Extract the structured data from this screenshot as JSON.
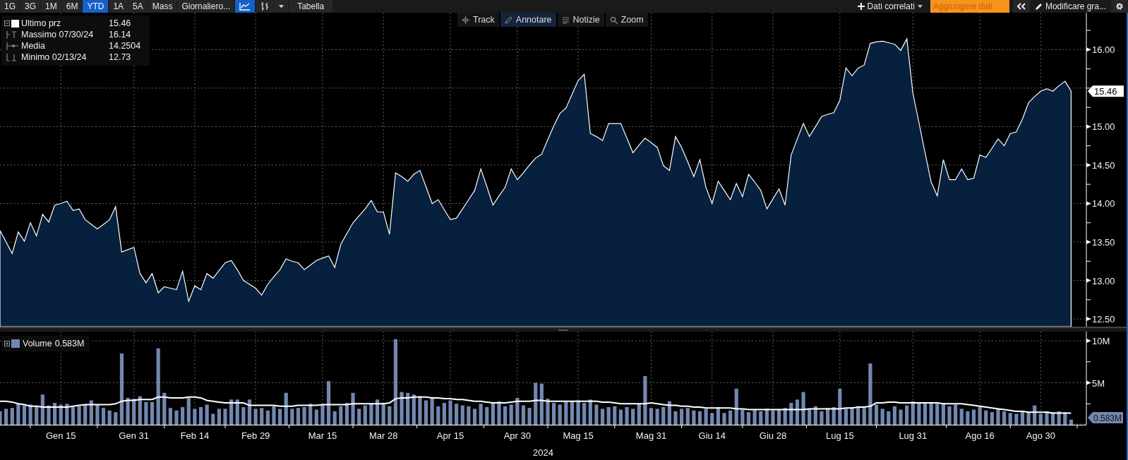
{
  "toolbar": {
    "periods": [
      {
        "label": "1G",
        "selected": false
      },
      {
        "label": "3G",
        "selected": false
      },
      {
        "label": "1M",
        "selected": false
      },
      {
        "label": "6M",
        "selected": false
      },
      {
        "label": "YTD",
        "selected": true
      },
      {
        "label": "1A",
        "selected": false
      },
      {
        "label": "5A",
        "selected": false
      },
      {
        "label": "Mass",
        "selected": false
      }
    ],
    "frequency": "Giornaliero...",
    "chart_types": [
      {
        "kind": "line",
        "selected": true
      },
      {
        "kind": "bars",
        "selected": false
      }
    ],
    "table_button": "Tabella",
    "related_data": "Dati correlati",
    "add_data": {
      "placeholder": "Aggiungere dati"
    },
    "edit_chart": "Modificare gra..."
  },
  "price_panel": {
    "legend": [
      {
        "kind": "last",
        "value": "15.46"
      },
      {
        "kind": "high",
        "label": "Massimo 07/30/24",
        "value": "16.14"
      },
      {
        "kind": "average",
        "label": "Media",
        "value": "14.2504"
      },
      {
        "kind": "low",
        "label": "Minimo 02/13/24",
        "value": "12.73"
      }
    ],
    "tools": [
      {
        "kind": "track",
        "label": "Track",
        "selected": false
      },
      {
        "kind": "annotate",
        "label": "Annotare",
        "selected": true
      },
      {
        "kind": "news",
        "label": "Notizie",
        "selected": false
      },
      {
        "kind": "zoom",
        "label": "Zoom",
        "selected": false
      }
    ],
    "last_tag": "15.46",
    "chart_data": {
      "type": "area",
      "grid": true,
      "ylim": [
        12.4,
        16.48
      ],
      "series": [
        {
          "name": "Ultimo prz",
          "color": "#ffffff",
          "values": [
            13.65,
            13.5,
            13.35,
            13.63,
            13.51,
            13.75,
            13.58,
            13.86,
            13.76,
            13.98,
            14.0,
            14.03,
            13.91,
            13.93,
            13.79,
            13.73,
            13.67,
            13.73,
            13.79,
            13.96,
            13.37,
            13.4,
            13.43,
            13.09,
            12.97,
            13.09,
            12.84,
            12.92,
            12.9,
            12.88,
            13.12,
            12.73,
            12.93,
            12.88,
            13.09,
            13.03,
            13.13,
            13.23,
            13.26,
            13.14,
            13.0,
            12.95,
            12.9,
            12.81,
            12.95,
            13.05,
            13.14,
            13.28,
            13.25,
            13.23,
            13.14,
            13.2,
            13.26,
            13.29,
            13.32,
            13.17,
            13.47,
            13.61,
            13.75,
            13.84,
            13.93,
            14.04,
            13.89,
            13.89,
            13.6,
            14.4,
            14.35,
            14.29,
            14.38,
            14.43,
            14.22,
            14.0,
            14.05,
            13.92,
            13.79,
            13.81,
            13.93,
            14.05,
            14.17,
            14.45,
            14.22,
            13.98,
            14.1,
            14.21,
            14.45,
            14.31,
            14.4,
            14.5,
            14.59,
            14.64,
            14.83,
            15.01,
            15.17,
            15.24,
            15.42,
            15.6,
            15.68,
            14.91,
            14.87,
            14.82,
            15.04,
            15.04,
            15.04,
            14.85,
            14.66,
            14.76,
            14.85,
            14.79,
            14.73,
            14.49,
            14.43,
            14.87,
            14.73,
            14.54,
            14.35,
            14.57,
            14.21,
            14.0,
            14.29,
            14.17,
            14.05,
            14.26,
            14.09,
            14.38,
            14.28,
            14.17,
            13.93,
            14.06,
            14.19,
            13.98,
            14.63,
            14.84,
            15.04,
            14.87,
            15.0,
            15.13,
            15.16,
            15.18,
            15.34,
            15.76,
            15.66,
            15.76,
            15.8,
            16.08,
            16.1,
            16.11,
            16.09,
            16.07,
            15.99,
            16.14,
            15.43,
            15.05,
            14.66,
            14.28,
            14.1,
            14.57,
            14.31,
            14.31,
            14.45,
            14.31,
            14.33,
            14.63,
            14.6,
            14.72,
            14.84,
            14.75,
            14.91,
            14.93,
            15.1,
            15.31,
            15.39,
            15.46,
            15.49,
            15.46,
            15.53,
            15.59,
            15.46
          ]
        }
      ],
      "yticks": [
        {
          "value": 12.5,
          "label": "12.50"
        },
        {
          "value": 13,
          "label": "13.00"
        },
        {
          "value": 13.5,
          "label": "13.50"
        },
        {
          "value": 14,
          "label": "14.00"
        },
        {
          "value": 14.5,
          "label": "14.50"
        },
        {
          "value": 15,
          "label": "15.00"
        },
        {
          "value": 16,
          "label": "16.00"
        }
      ]
    }
  },
  "volume_panel": {
    "legend": {
      "value": "0.583M"
    },
    "last_tag": "0.583M",
    "chart_data": {
      "type": "bar",
      "grid": true,
      "xlabel": "2024",
      "ylim": [
        0,
        11.1
      ],
      "categories": [
        null,
        null,
        null,
        null,
        null,
        null,
        null,
        null,
        null,
        null,
        "Gen 15",
        null,
        null,
        null,
        null,
        null,
        null,
        null,
        null,
        null,
        null,
        null,
        "Gen 31",
        null,
        null,
        null,
        null,
        null,
        null,
        null,
        null,
        null,
        "Feb 14",
        null,
        null,
        null,
        null,
        null,
        null,
        null,
        null,
        null,
        "Feb 29",
        null,
        null,
        null,
        null,
        null,
        null,
        null,
        null,
        null,
        null,
        "Mar 15",
        null,
        null,
        null,
        null,
        null,
        null,
        null,
        null,
        null,
        "Mar 28",
        null,
        null,
        null,
        null,
        null,
        null,
        null,
        null,
        null,
        null,
        "Apr 15",
        null,
        null,
        null,
        null,
        null,
        null,
        null,
        null,
        null,
        null,
        "Apr 30",
        null,
        null,
        null,
        null,
        null,
        null,
        null,
        null,
        null,
        "Mag 15",
        null,
        null,
        null,
        null,
        null,
        null,
        null,
        null,
        null,
        null,
        null,
        "Mag 31",
        null,
        null,
        null,
        null,
        null,
        null,
        null,
        null,
        null,
        "Giu 14",
        null,
        null,
        null,
        null,
        null,
        null,
        null,
        null,
        null,
        "Giu 28",
        null,
        null,
        null,
        null,
        null,
        null,
        null,
        null,
        null,
        null,
        "Lug 15",
        null,
        null,
        null,
        null,
        null,
        null,
        null,
        null,
        null,
        null,
        null,
        "Lug 31",
        null,
        null,
        null,
        null,
        null,
        null,
        null,
        null,
        null,
        null,
        "Ago 16",
        null,
        null,
        null,
        null,
        null,
        null,
        null,
        null,
        null,
        "Ago 30",
        null,
        null,
        null,
        null,
        null
      ],
      "series": [
        {
          "name": "Volume",
          "color": "#7388b0",
          "values": [
            1.6,
            1.9,
            2.0,
            2.5,
            2.3,
            2.4,
            2.2,
            3.6,
            2.3,
            2.6,
            2.4,
            2.5,
            2.1,
            2.2,
            2.4,
            2.9,
            2.4,
            2.0,
            1.7,
            1.5,
            8.5,
            3.2,
            3.1,
            3.4,
            2.7,
            2.7,
            9.1,
            3.8,
            2.0,
            1.7,
            2.1,
            3.2,
            1.9,
            2.1,
            2.4,
            1.3,
            1.9,
            1.9,
            3.0,
            3.0,
            2.1,
            3.0,
            1.9,
            2.0,
            1.7,
            2.2,
            1.9,
            3.8,
            1.9,
            2.0,
            2.1,
            2.5,
            1.8,
            2.4,
            5.2,
            1.6,
            2.2,
            2.6,
            3.8,
            1.9,
            2.3,
            2.5,
            3.0,
            2.6,
            2.2,
            10.2,
            3.9,
            3.8,
            3.6,
            3.4,
            2.9,
            3.3,
            2.2,
            2.6,
            2.9,
            2.5,
            2.3,
            2.2,
            1.9,
            2.5,
            2.1,
            2.6,
            2.8,
            2.2,
            2.4,
            3.2,
            2.3,
            2.0,
            5.0,
            4.9,
            3.1,
            2.6,
            2.4,
            2.7,
            2.8,
            2.9,
            2.6,
            3.0,
            2.4,
            1.9,
            2.1,
            2.2,
            1.8,
            2.1,
            1.9,
            2.5,
            5.8,
            2.0,
            1.9,
            2.1,
            2.8,
            1.6,
            1.9,
            2.0,
            1.7,
            1.6,
            1.9,
            1.4,
            2.1,
            1.4,
            1.7,
            4.3,
            1.8,
            1.5,
            1.8,
            1.6,
            1.9,
            1.7,
            1.8,
            2.0,
            2.6,
            3.0,
            3.9,
            1.9,
            2.2,
            1.6,
            2.0,
            2.1,
            4.3,
            1.9,
            2.1,
            2.2,
            2.0,
            7.3,
            2.4,
            1.9,
            1.6,
            2.2,
            1.8,
            2.3,
            2.8,
            2.7,
            2.6,
            2.7,
            2.5,
            2.6,
            2.2,
            2.4,
            1.9,
            1.6,
            1.8,
            2.1,
            1.7,
            1.5,
            1.9,
            1.6,
            1.4,
            1.3,
            1.6,
            1.5,
            2.3,
            1.3,
            1.6,
            1.5,
            1.6,
            1.5,
            0.6
          ]
        },
        {
          "type": "line",
          "color": "#ffffff",
          "values": [
            2.8,
            2.8,
            2.7,
            2.5,
            2.4,
            2.2,
            2.2,
            2.1,
            2.1,
            2.1,
            2.1,
            2.1,
            2.2,
            2.3,
            2.4,
            2.4,
            2.4,
            2.4,
            2.4,
            2.5,
            2.8,
            2.9,
            2.9,
            3.0,
            3.0,
            3.0,
            3.3,
            3.3,
            3.2,
            3.2,
            3.2,
            3.3,
            3.3,
            3.2,
            2.9,
            2.8,
            2.7,
            2.6,
            2.6,
            2.6,
            2.6,
            2.3,
            2.3,
            2.3,
            2.3,
            2.3,
            2.2,
            2.2,
            2.2,
            2.3,
            2.3,
            2.3,
            2.3,
            2.4,
            2.4,
            2.4,
            2.4,
            2.4,
            2.5,
            2.5,
            2.5,
            2.5,
            2.5,
            2.5,
            2.6,
            3.1,
            3.2,
            3.2,
            3.3,
            3.3,
            3.3,
            3.2,
            3.2,
            3.1,
            3.1,
            3.0,
            3.0,
            2.9,
            2.8,
            2.8,
            2.7,
            2.6,
            2.6,
            2.6,
            2.7,
            2.8,
            2.8,
            2.8,
            2.9,
            2.9,
            2.8,
            2.8,
            2.8,
            2.8,
            2.8,
            2.8,
            2.8,
            2.8,
            2.8,
            2.7,
            2.7,
            2.6,
            2.5,
            2.5,
            2.5,
            2.5,
            2.5,
            2.6,
            2.5,
            2.4,
            2.3,
            2.3,
            2.2,
            2.2,
            2.1,
            2.1,
            2.0,
            2.0,
            2.0,
            2.0,
            2.0,
            1.9,
            1.9,
            1.8,
            1.8,
            1.8,
            1.8,
            1.8,
            1.8,
            1.8,
            1.8,
            1.8,
            1.8,
            1.9,
            1.9,
            1.9,
            1.9,
            1.9,
            1.9,
            2.0,
            2.0,
            2.1,
            2.1,
            2.2,
            2.6,
            2.6,
            2.7,
            2.7,
            2.6,
            2.6,
            2.6,
            2.6,
            2.6,
            2.6,
            2.6,
            2.5,
            2.5,
            2.5,
            2.5,
            2.4,
            2.3,
            2.2,
            2.1,
            2.0,
            1.9,
            1.8,
            1.7,
            1.6,
            1.6,
            1.5,
            1.5,
            1.5,
            1.5,
            1.4,
            1.4,
            1.4,
            1.4
          ]
        }
      ],
      "yticks": [
        {
          "value": 5,
          "label": "5M"
        },
        {
          "value": 10,
          "label": "10M"
        }
      ]
    }
  }
}
